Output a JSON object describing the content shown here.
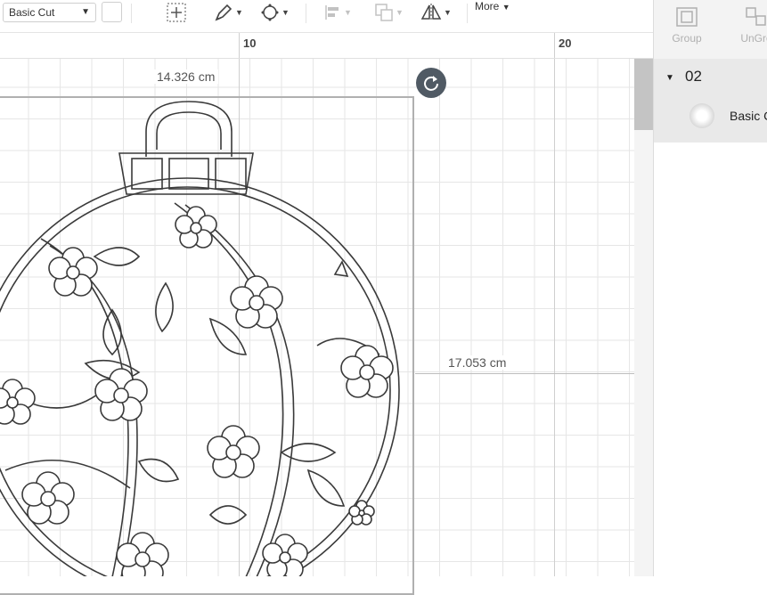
{
  "toolbar": {
    "operation_value": "Basic Cut",
    "more_label": "More"
  },
  "ruler": {
    "mark_10": "10",
    "mark_20": "20"
  },
  "canvas": {
    "width_readout": "14.326 cm",
    "height_readout": "17.053 cm"
  },
  "panel": {
    "group_label": "Group",
    "ungroup_label": "UnGro",
    "layer_name": "02",
    "layer_item": "Basic C"
  }
}
